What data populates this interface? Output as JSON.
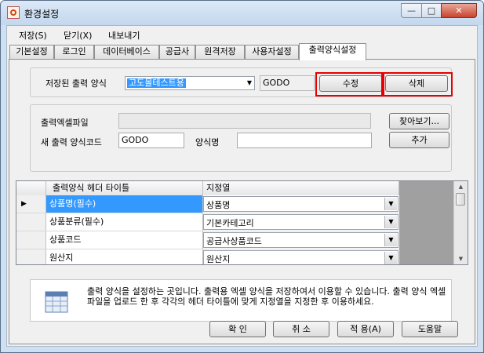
{
  "window": {
    "title": "환경설정",
    "minimize_glyph": "—",
    "maximize_glyph": "□",
    "close_glyph": "✕"
  },
  "menubar": {
    "items": [
      {
        "label": "저장(S)"
      },
      {
        "label": "닫기(X)"
      },
      {
        "label": "내보내기"
      }
    ]
  },
  "tabs": [
    {
      "label": "기본설정"
    },
    {
      "label": "로그인"
    },
    {
      "label": "데이터베이스"
    },
    {
      "label": "공급사"
    },
    {
      "label": "원격저장"
    },
    {
      "label": "사용자설정"
    },
    {
      "label": "출력양식설정",
      "active": true
    }
  ],
  "saved_format": {
    "label": "저장된 출력 양식",
    "selected": "고도몰테스트용",
    "code": "GODO",
    "edit_button": "수정",
    "delete_button": "삭제"
  },
  "new_format": {
    "excel_label": "출력엑셀파일",
    "excel_value": "",
    "browse_button": "찾아보기...",
    "code_label": "새 출력 양식코드",
    "code_value": "GODO",
    "name_label": "양식명",
    "name_value": "",
    "add_button": "추가"
  },
  "grid": {
    "columns": [
      "출력양식 헤더 타이틀",
      "지정열"
    ],
    "rows": [
      {
        "title": "상품명(필수)",
        "column": "상품명",
        "current": true,
        "selected": true
      },
      {
        "title": "상품분류(필수)",
        "column": "기본카테고리"
      },
      {
        "title": "상품코드",
        "column": "공급사상품코드"
      },
      {
        "title": "원산지",
        "column": "원산지"
      }
    ]
  },
  "info": {
    "text": "출력 양식을 설정하는 곳입니다. 출력용 엑셀 양식을 저장하여서 이용할 수 있습니다. 출력 양식 엑셀파일을 업로드 한 후 각각의 헤더 타이틀에 맞게 지정열을 지정한 후 이용하세요."
  },
  "footer": {
    "ok": "확 인",
    "cancel": "취 소",
    "apply": "적 용(A)",
    "help": "도움말"
  },
  "colors": {
    "highlight": "#e60000",
    "selection": "#3399ff"
  }
}
